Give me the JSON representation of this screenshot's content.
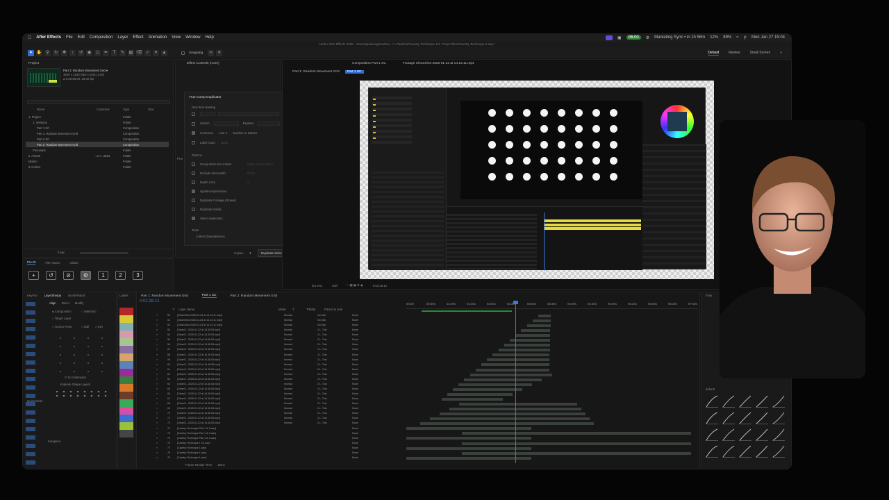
{
  "menubar": {
    "app_name": "After Effects",
    "items": [
      "File",
      "Edit",
      "Composition",
      "Layer",
      "Effect",
      "Animation",
      "View",
      "Window",
      "Help"
    ],
    "status": {
      "time_pill": "06:00",
      "calendar": "Marketing Sync • in 1h 56m",
      "stat1": "12%",
      "battery": "89%",
      "clock": "Mon Jan 27  15:04"
    }
  },
  "titlebar": "Adobe After Effects 2025 - /Users/jackvaughan/Doc.../ 1 Pipeline/Cavetry Technique 1/3. Project files/Cavetry Technique 2.aep *",
  "toolbar": {
    "snapping": "Snapping"
  },
  "workspaces": [
    "Default",
    "Review",
    "Small Screen"
  ],
  "project": {
    "tab": "Project",
    "thumb_name": "Part 2: Random Movement Grid ▾",
    "thumb_info1": "3840 x 2160 (960 x 540) (1.00)",
    "thumb_info2": "Δ 0:00:05:00, 25.00 fps",
    "columns": [
      "Name",
      "Comment",
      "Type",
      "Size"
    ],
    "rows": [
      {
        "name": "1. Project",
        "type": "Folder",
        "sel": false,
        "ind": 0
      },
      {
        "name": "1. Versions",
        "type": "Folder",
        "sel": false,
        "ind": 1
      },
      {
        "name": "Part 1 SC",
        "type": "Composition",
        "sel": false,
        "ind": 2
      },
      {
        "name": "Part 1: Random Movement Grid",
        "type": "Composition",
        "sel": false,
        "ind": 2
      },
      {
        "name": "Part 2 SC",
        "type": "Composition",
        "sel": false,
        "ind": 2
      },
      {
        "name": "Part 2: Random Movement Grid",
        "type": "Composition",
        "sel": true,
        "ind": 2
      },
      {
        "name": "Precomps",
        "type": "Folder",
        "sel": false,
        "ind": 1
      },
      {
        "name": "2. Assets",
        "type": "Folder",
        "sel": false,
        "ind": 0,
        "size": "..2 A...ab13"
      },
      {
        "name": "Motion",
        "type": "Folder",
        "sel": false,
        "ind": 0
      },
      {
        "name": "0.Archive",
        "type": "Folder",
        "sel": false,
        "ind": 0
      }
    ],
    "bpc": "8 bpc",
    "tabs2": [
      "Pro IO",
      "File Hunter",
      "Initials"
    ],
    "buttons": [
      "+",
      "↺",
      "⊘",
      "⚙",
      "1",
      "2",
      "3"
    ]
  },
  "effects": {
    "tab": "Effect Controls (none)",
    "title": "True Comp Duplicator",
    "new_item_naming": "New Item Naming",
    "suffix": "Suffix",
    "search": "Search",
    "replace": "Replace",
    "increment": "Increment",
    "last": "Last",
    "number_in_names": "Number In Names",
    "label_color": "Label Color",
    "none": "None",
    "options": "Options",
    "opts": [
      {
        "label": "Group Items Into Folder",
        "on": false,
        "extra": "Name of new folder"
      },
      {
        "label": "Exclude Items With",
        "on": false,
        "extra": "Prefix"
      },
      {
        "label": "Depth Limit",
        "on": false,
        "extra": "2"
      },
      {
        "label": "Update Expressions",
        "on": true,
        "extra": ""
      },
      {
        "label": "Duplicate Footage (Slower)",
        "on": false,
        "extra": ""
      },
      {
        "label": "Duplicate Solids",
        "on": false,
        "extra": ""
      },
      {
        "label": "Select duplicates",
        "on": true,
        "extra": ""
      }
    ],
    "tools": "Tools",
    "collect": "Collect Dependencies",
    "copies_label": "Copies",
    "copies_value": "1",
    "duplicate_btn": "Duplicate Selected",
    "side_tab": "Proj"
  },
  "viewer": {
    "tabs": [
      "Composition Part 1 SC",
      "Footage CleanShot 2025-01-23 at 14.13.11.mp4"
    ],
    "subtabs": [
      "Part 1: Random Movement Grid",
      "Part 1 SC"
    ],
    "zoom": "(61.6%)",
    "quality": "Half",
    "timecode": "0:02:28:12"
  },
  "keyframe": {
    "tabs": [
      "KeyFrsl",
      "LayerSherpa",
      "BorderPatrol"
    ],
    "labels_tab": "Labels",
    "align_tabs": [
      "Align",
      "Direct",
      "Modify"
    ],
    "radios": [
      "Composition",
      "Selection",
      "Target Layer",
      "Anchor Point",
      "Null",
      "Key"
    ],
    "ty": "© Ty Gettemann",
    "explode": "Explode Shape Layers",
    "quick": "Quick Delet",
    "kangaroo": "Kangaroo",
    "label_colors": [
      "#b3282a",
      "#d9c83a",
      "#7fb0b3",
      "#d79aab",
      "#a7c493",
      "#8b6ea3",
      "#d6a56a",
      "#5a84b8",
      "#9b2b9a",
      "#3c7e3c",
      "#d8782a",
      "#6c3d28",
      "#3aaa5a",
      "#d64fa4",
      "#3d6ed1",
      "#9ac237",
      "#454545"
    ]
  },
  "timeline": {
    "tabs": [
      "Part 1: Random Movement Grid",
      "Part 1 SC",
      "Part 2: Random Movement Grid"
    ],
    "timecode": "0:02:28:12",
    "headers": [
      "#",
      "Layer Name",
      "Mode",
      "T",
      "TrkMat",
      "Parent & Link"
    ],
    "ruler": [
      "00:00",
      "00:30s",
      "01:00s",
      "01:30s",
      "02:00s",
      "02:30s",
      "03:00s",
      "03:30s",
      "04:00s",
      "04:30s",
      "05:00s",
      "05:30s",
      "06:00s",
      "06:30s",
      "07:00s"
    ],
    "rows": [
      {
        "n": "50",
        "name": "[CleanShot 2025-01-23 at 14.13.11.mp4]",
        "mode": "Normal",
        "trk": "No Mat"
      },
      {
        "n": "51",
        "name": "[CleanShot 2025-01-23 at 14.13.11.mp4]",
        "mode": "Normal",
        "trk": "No Mat"
      },
      {
        "n": "52",
        "name": "[CleanShot 2025-01-23 at 14.13.11.mp4]",
        "mode": "Normal",
        "trk": "No Mat"
      },
      {
        "n": "53",
        "name": "[CleanS...2025-01-22 at 14.38.53.mp4]",
        "mode": "Normal",
        "trk": "2.L. Tutc"
      },
      {
        "n": "54",
        "name": "[CleanS...2025-01-22 at 14.38.53.mp4]",
        "mode": "Normal",
        "trk": "2.L. Tutc"
      },
      {
        "n": "55",
        "name": "[CleanS...2025-01-22 at 14.38.53.mp4]",
        "mode": "Normal",
        "trk": "2.L. Tutc"
      },
      {
        "n": "56",
        "name": "[CleanS...2025-01-22 at 14.38.53.mp4]",
        "mode": "Normal",
        "trk": "2.L. Tutc"
      },
      {
        "n": "57",
        "name": "[CleanS...2025-01-22 at 14.38.53.mp4]",
        "mode": "Normal",
        "trk": "2.L. Tutc"
      },
      {
        "n": "58",
        "name": "[CleanS...2025-01-22 at 14.38.53.mp4]",
        "mode": "Normal",
        "trk": "2.L. Tutc"
      },
      {
        "n": "59",
        "name": "[CleanS...2025-01-22 at 14.38.53.mp4]",
        "mode": "Normal",
        "trk": "2.L. Tutc"
      },
      {
        "n": "60",
        "name": "[CleanS...2025-01-22 at 14.38.53.mp4]",
        "mode": "Normal",
        "trk": "2.L. Tutc"
      },
      {
        "n": "61",
        "name": "[CleanS...2025-01-22 at 14.38.53.mp4]",
        "mode": "Normal",
        "trk": "2.L. Tutc"
      },
      {
        "n": "62",
        "name": "[CleanS...2025-01-22 at 14.38.53.mp4]",
        "mode": "Normal",
        "trk": "2.L. Tutc"
      },
      {
        "n": "63",
        "name": "[CleanS...2025-01-22 at 14.38.53.mp4]",
        "mode": "Normal",
        "trk": "2.L. Tutc"
      },
      {
        "n": "64",
        "name": "[CleanS...2025-01-22 at 14.38.53.mp4]",
        "mode": "Normal",
        "trk": "2.L. Tutc"
      },
      {
        "n": "65",
        "name": "[CleanS...2025-01-22 at 14.38.53.mp4]",
        "mode": "Normal",
        "trk": "2.L. Tutc"
      },
      {
        "n": "66",
        "name": "[CleanS...2025-01-22 at 14.38.53.mp4]",
        "mode": "Normal",
        "trk": "2.L. Tutc"
      },
      {
        "n": "67",
        "name": "[CleanS...2025-01-22 at 14.38.53.mp4]",
        "mode": "Normal",
        "trk": "2.L. Tutc"
      },
      {
        "n": "68",
        "name": "[CleanS...2025-01-22 at 14.38.53.mp4]",
        "mode": "Normal",
        "trk": "2.L. Tutc"
      },
      {
        "n": "69",
        "name": "[CleanS...2025-01-22 at 14.38.53.mp4]",
        "mode": "Normal",
        "trk": "2.L. Tutc"
      },
      {
        "n": "70",
        "name": "[CleanS...2025-01-22 at 14.38.53.mp4]",
        "mode": "Normal",
        "trk": "2.L. Tutc"
      },
      {
        "n": "71",
        "name": "[CleanS...2025-01-22 at 14.38.53.mp4]",
        "mode": "Normal",
        "trk": "2.L. Tutc"
      },
      {
        "n": "72",
        "name": "[CleanS...2025-01-22 at 14.38.53.mp4]",
        "mode": "Normal",
        "trk": "2.L. Tutc"
      },
      {
        "n": "73",
        "name": "[Cavetry Technique Part 1 & 2.wav]",
        "mode": "",
        "trk": ""
      },
      {
        "n": "74",
        "name": "[Cavetry Technique Part 1 & 2.wav]",
        "mode": "",
        "trk": ""
      },
      {
        "n": "75",
        "name": "[Cavetry Technique Part 1 & 2.wav]",
        "mode": "",
        "trk": ""
      },
      {
        "n": "76",
        "name": "[Cavetry Technique 1 V2.wav]",
        "mode": "",
        "trk": ""
      },
      {
        "n": "77",
        "name": "[Cavetry Technique 1.wav]",
        "mode": "",
        "trk": ""
      },
      {
        "n": "78",
        "name": "[Cavetry Technique 1.wav]",
        "mode": "",
        "trk": ""
      },
      {
        "n": "79",
        "name": "[Cavetry Technique 1.wav]",
        "mode": "",
        "trk": ""
      }
    ],
    "footer": "Frame Render Time",
    "footer_value": "10ms",
    "none": "None",
    "right_tab": "Flow"
  },
  "flow": {
    "preset": "default"
  }
}
